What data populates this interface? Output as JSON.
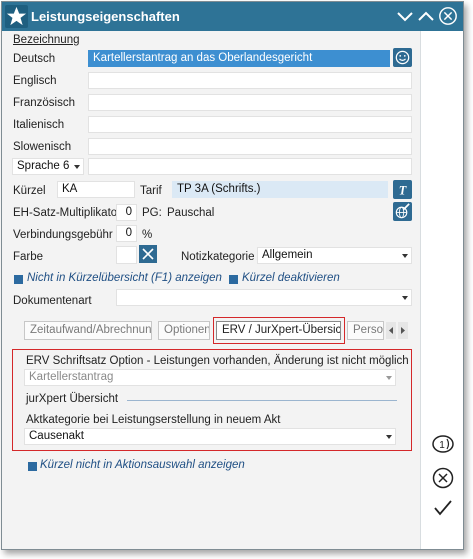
{
  "window": {
    "title": "Leistungseigenschaften"
  },
  "labels": {
    "bezeichnung": "Bezeichnung",
    "deutsch": "Deutsch",
    "englisch": "Englisch",
    "franzoesisch": "Französisch",
    "italienisch": "Italienisch",
    "slowenisch": "Slowenisch",
    "kuerzel": "Kürzel",
    "tarif": "Tarif",
    "eh_satz": "EH-Satz-Multiplikator",
    "pg": "PG:",
    "pauschal": "Pauschal",
    "verbindung": "Verbindungsgebühr",
    "percent": "%",
    "farbe": "Farbe",
    "notizkategorie": "Notizkategorie",
    "dokumentenart": "Dokumentenart"
  },
  "fields": {
    "deutsch": "Kartellerstantrag an das Oberlandesgericht",
    "englisch": "",
    "franzoesisch": "",
    "italienisch": "",
    "slowenisch": "",
    "sprache6_select": "Sprache 6",
    "sprache6": "",
    "kuerzel": "KA",
    "tarif": "TP 3A (Schrifts.)",
    "eh_satz": "0",
    "verbindung": "0",
    "notizkategorie": "Allgemein",
    "dokumentenart": ""
  },
  "checkboxes": {
    "not_in_overview": "Nicht in Kürzelübersicht (F1) anzeigen",
    "deactivate": "Kürzel deaktivieren",
    "not_in_action": "Kürzel nicht in Aktionsauswahl anzeigen"
  },
  "tabs": [
    {
      "label": "Zeitaufwand/Abrechnung"
    },
    {
      "label": "Optionen"
    },
    {
      "label": "ERV / JurXpert-Übersicht"
    },
    {
      "label": "Person"
    }
  ],
  "erv_panel": {
    "heading": "ERV Schriftsatz Option - Leistungen vorhanden, Änderung ist nicht möglich",
    "erv_value": "Kartellerstantrag",
    "jurxpert_heading": "jurXpert Übersicht",
    "akt_label": "Aktkategorie bei Leistungserstellung in neuem Akt",
    "akt_value": "Causenakt"
  },
  "colors": {
    "titlebar": "#2e7396",
    "accent": "#3d8fd1",
    "highlight_box": "#d4282a"
  },
  "icons": {
    "window": "star-icon",
    "smiley": "smiley-icon",
    "tarif": "italic-t-icon",
    "pauschal": "edit-globe-icon",
    "farbe_clear": "cross-icon",
    "side_counter": "counter-icon",
    "side_cancel": "cancel-circle-icon",
    "side_ok": "checkmark-icon"
  }
}
